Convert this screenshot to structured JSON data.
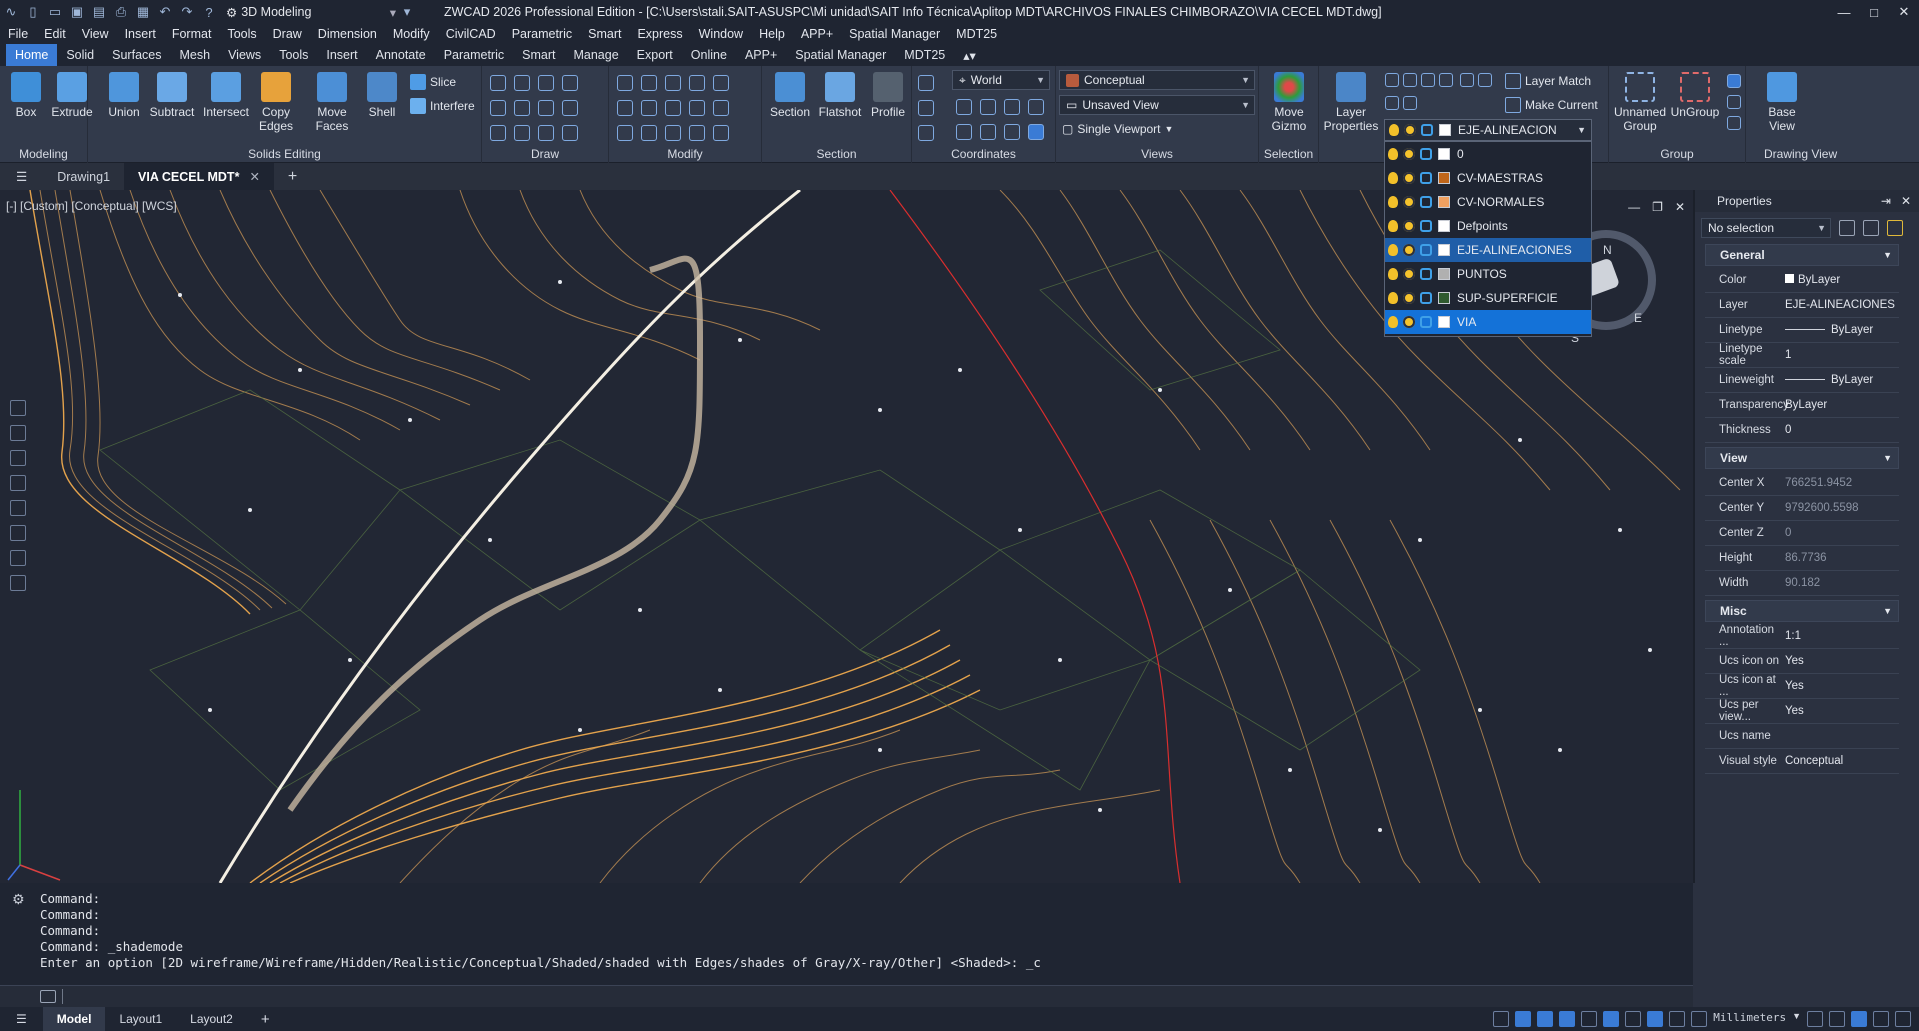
{
  "app": {
    "workspace": "3D Modeling",
    "window_title": "ZWCAD 2026 Professional Edition - [C:\\Users\\stali.SAIT-ASUSPC\\Mi unidad\\SAIT Info Técnica\\Aplitop MDT\\ARCHIVOS FINALES CHIMBORAZO\\VIA CECEL MDT.dwg]"
  },
  "menu": [
    "File",
    "Edit",
    "View",
    "Insert",
    "Format",
    "Tools",
    "Draw",
    "Dimension",
    "Modify",
    "CivilCAD",
    "Parametric",
    "Smart",
    "Express",
    "Window",
    "Help",
    "APP+",
    "Spatial Manager",
    "MDT25"
  ],
  "ribbon_tabs": [
    "Home",
    "Solid",
    "Surfaces",
    "Mesh",
    "Views",
    "Tools",
    "Insert",
    "Annotate",
    "Parametric",
    "Smart",
    "Manage",
    "Export",
    "Online",
    "APP+",
    "Spatial Manager",
    "MDT25"
  ],
  "ribbon": {
    "modeling": {
      "title": "Modeling",
      "box": "Box",
      "extrude": "Extrude"
    },
    "solids": {
      "title": "Solids Editing",
      "union": "Union",
      "subtract": "Subtract",
      "intersect": "Intersect",
      "copy_edges": "Copy Edges",
      "move_faces": "Move Faces",
      "shell": "Shell",
      "slice": "Slice",
      "interfere": "Interfere"
    },
    "draw": {
      "title": "Draw"
    },
    "modify": {
      "title": "Modify"
    },
    "section": {
      "title": "Section",
      "section": "Section",
      "flatshot": "Flatshot",
      "profile": "Profile"
    },
    "coordinates": {
      "title": "Coordinates",
      "ucs": "World"
    },
    "views": {
      "title": "Views",
      "visual_style": "Conceptual",
      "named_view": "Unsaved View",
      "viewport": "Single Viewport"
    },
    "selection": {
      "title": "Selection",
      "move_gizmo": "Move Gizmo"
    },
    "layers": {
      "layer_properties": "Layer Properties",
      "layer_match": "Layer Match",
      "make_current": "Make Current",
      "current_layer": "EJE-ALINEACION"
    },
    "group": {
      "title": "Group",
      "unnamed": "Unnamed Group",
      "ungroup": "UnGroup"
    },
    "drawing_view": {
      "title": "Drawing View",
      "base_view": "Base View"
    }
  },
  "layers": [
    {
      "name": "0",
      "color": "#ffffff"
    },
    {
      "name": "CV-MAESTRAS",
      "color": "#c0661a"
    },
    {
      "name": "CV-NORMALES",
      "color": "#f0a060"
    },
    {
      "name": "Defpoints",
      "color": "#ffffff"
    },
    {
      "name": "EJE-ALINEACIONES",
      "color": "#ffffff"
    },
    {
      "name": "PUNTOS",
      "color": "#b0b0b0"
    },
    {
      "name": "SUP-SUPERFICIE",
      "color": "#2f5a2f"
    },
    {
      "name": "VIA",
      "color": "#ffffff"
    }
  ],
  "doc_tabs": [
    "Drawing1",
    "VIA CECEL MDT*"
  ],
  "viewport_label": "[-] [Custom] [Conceptual] [WCS]",
  "properties": {
    "title": "Properties",
    "selection": "No selection",
    "general": {
      "title": "General",
      "rows": [
        [
          "Color",
          "ByLayer"
        ],
        [
          "Layer",
          "EJE-ALINEACIONES"
        ],
        [
          "Linetype",
          "ByLayer"
        ],
        [
          "Linetype scale",
          "1"
        ],
        [
          "Lineweight",
          "ByLayer"
        ],
        [
          "Transparency",
          "ByLayer"
        ],
        [
          "Thickness",
          "0"
        ]
      ]
    },
    "view": {
      "title": "View",
      "rows": [
        [
          "Center X",
          "766251.9452"
        ],
        [
          "Center Y",
          "9792600.5598"
        ],
        [
          "Center Z",
          "0"
        ],
        [
          "Height",
          "86.7736"
        ],
        [
          "Width",
          "90.182"
        ]
      ]
    },
    "misc": {
      "title": "Misc",
      "rows": [
        [
          "Annotation ...",
          "1:1"
        ],
        [
          "Ucs icon on",
          "Yes"
        ],
        [
          "Ucs icon at ...",
          "Yes"
        ],
        [
          "Ucs per view...",
          "Yes"
        ],
        [
          "Ucs name",
          ""
        ],
        [
          "Visual style",
          "Conceptual"
        ]
      ]
    }
  },
  "command": [
    "Command:",
    "Command:",
    "Command:",
    "Command: _shademode",
    "Enter an option [2D wireframe/Wireframe/Hidden/Realistic/Conceptual/Shaded/shaded with Edges/shades of Gray/X-ray/Other] <Shaded>: _c"
  ],
  "layout_tabs": [
    "Model",
    "Layout1",
    "Layout2"
  ],
  "units": "Millimeters",
  "compass": {
    "n": "N",
    "e": "E",
    "s": "S"
  }
}
